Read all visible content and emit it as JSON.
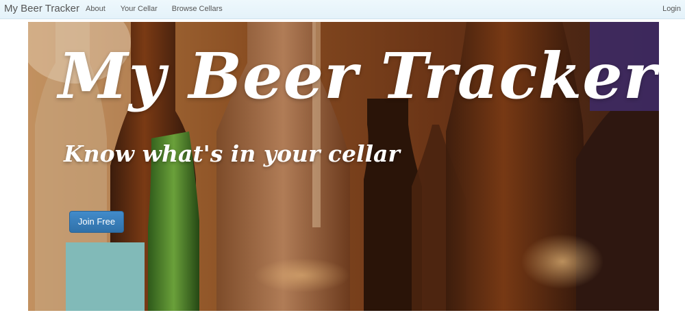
{
  "navbar": {
    "brand": "My Beer Tracker",
    "links": [
      "About",
      "Your Cellar",
      "Browse Cellars"
    ],
    "login": "Login"
  },
  "hero": {
    "title": "My Beer Tracker",
    "subtitle": "Know what's in your cellar",
    "cta_label": "Join Free"
  },
  "colors": {
    "navbar_bg": "#e6f4fb",
    "button": "#428bca",
    "text": "#555555"
  }
}
